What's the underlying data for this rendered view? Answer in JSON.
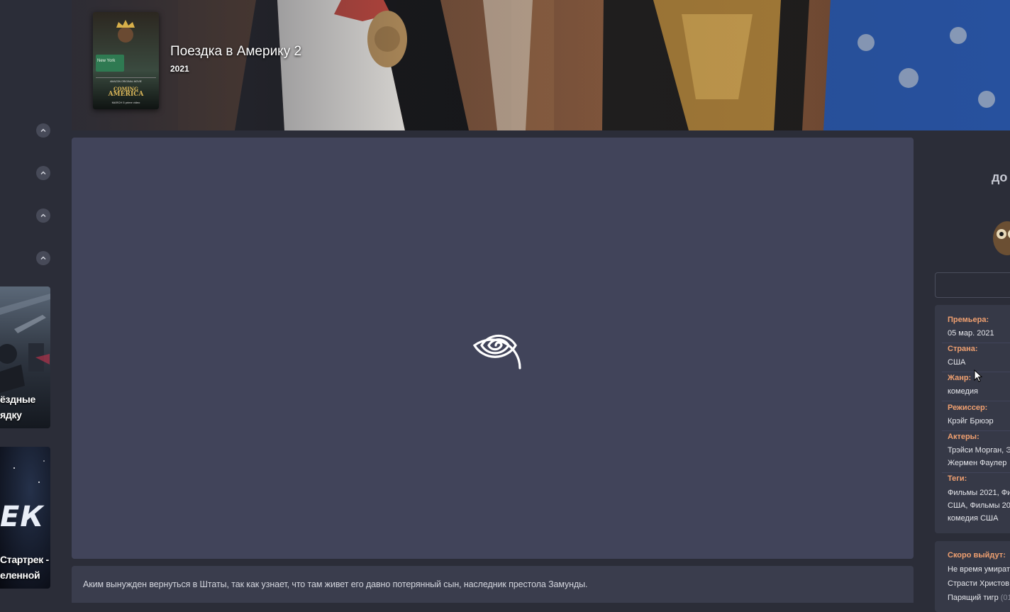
{
  "hero": {
    "title": "Поездка в Америку 2",
    "year": "2021",
    "poster_text": {
      "city": "New York",
      "studio": "AMAZON ORIGINAL MOVIE",
      "logo_line1": "COMING",
      "logo_line2": "AMERICA",
      "release": "MARCH 5",
      "service": "prime video"
    }
  },
  "left_rail": {
    "scroll_buttons": [
      "chevron-up-icon",
      "chevron-up-icon",
      "chevron-up-icon",
      "chevron-up-icon"
    ],
    "cards": [
      {
        "caption_line1": "ёздные",
        "caption_line2": "ядку"
      },
      {
        "art_text": "ЕК",
        "caption_line1": "Стартрек -",
        "caption_line2": "еленной"
      }
    ]
  },
  "player": {
    "loader_icon": "spiral-loader-icon"
  },
  "description": "Аким вынужден вернуться в Штаты, так как узнает, что там живет его давно потерянный сын, наследник престола Замунды.",
  "sidebar": {
    "heading": "до",
    "info": [
      {
        "label": "Премьера:",
        "lines": [
          "05 мар. 2021"
        ]
      },
      {
        "label": "Страна:",
        "lines": [
          "США"
        ]
      },
      {
        "label": "Жанр:",
        "lines": [
          "комедия"
        ]
      },
      {
        "label": "Режиссер:",
        "lines": [
          "Крэйг Брюэр"
        ]
      },
      {
        "label": "Актеры:",
        "lines": [
          "Трэйси Морган, Э",
          "Жермен Фаулер"
        ]
      },
      {
        "label": "Теги:",
        "lines": [
          "Фильмы 2021, Фи",
          "США, Фильмы 202",
          "комедия США"
        ]
      }
    ],
    "coming_soon": {
      "title": "Скоро выйдут:",
      "items": [
        {
          "name": "Не время умират",
          "extra": ""
        },
        {
          "name": "Страсти Христов",
          "extra": ""
        },
        {
          "name": "Парящий тигр",
          "extra": "(01"
        }
      ]
    }
  },
  "colors": {
    "background": "#2b2d38",
    "player": "#41445a",
    "accent_label": "#f0a070"
  }
}
